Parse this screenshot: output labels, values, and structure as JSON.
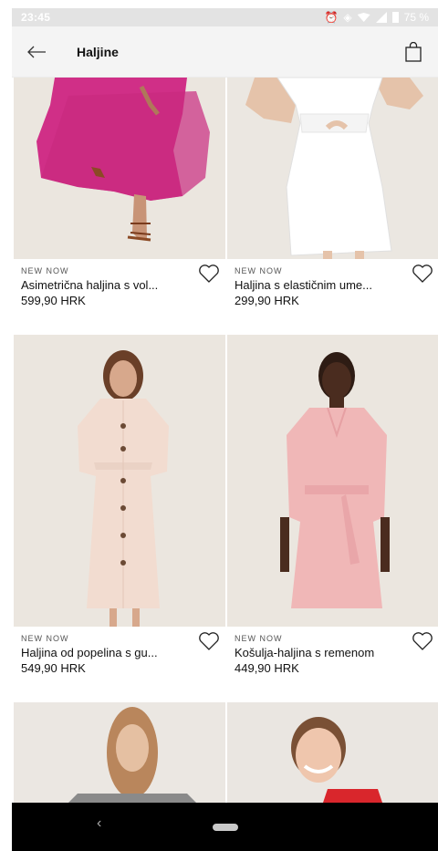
{
  "status": {
    "time": "23:45",
    "battery": "75 %"
  },
  "header": {
    "title": "Haljine"
  },
  "products": [
    {
      "tag": "NEW NOW",
      "name": "Asimetrična haljina s vol...",
      "price": "599,90 HRK"
    },
    {
      "tag": "NEW NOW",
      "name": "Haljina s elastičnim ume...",
      "price": "299,90 HRK"
    },
    {
      "tag": "NEW NOW",
      "name": "Haljina od popelina s gu...",
      "price": "549,90 HRK"
    },
    {
      "tag": "NEW NOW",
      "name": "Košulja-haljina s remenom",
      "price": "449,90 HRK"
    }
  ],
  "icons": {
    "back": "arrow-left-icon",
    "bag": "shopping-bag-icon",
    "wishlist": "heart-icon",
    "nav_back": "chevron-left-icon",
    "nav_home": "home-pill-icon"
  },
  "colors": {
    "header_bg": "#f4f4f4",
    "status_bg": "#e3e3e3",
    "nav_bg": "#000000",
    "photo_bg": "#ebe6df"
  }
}
